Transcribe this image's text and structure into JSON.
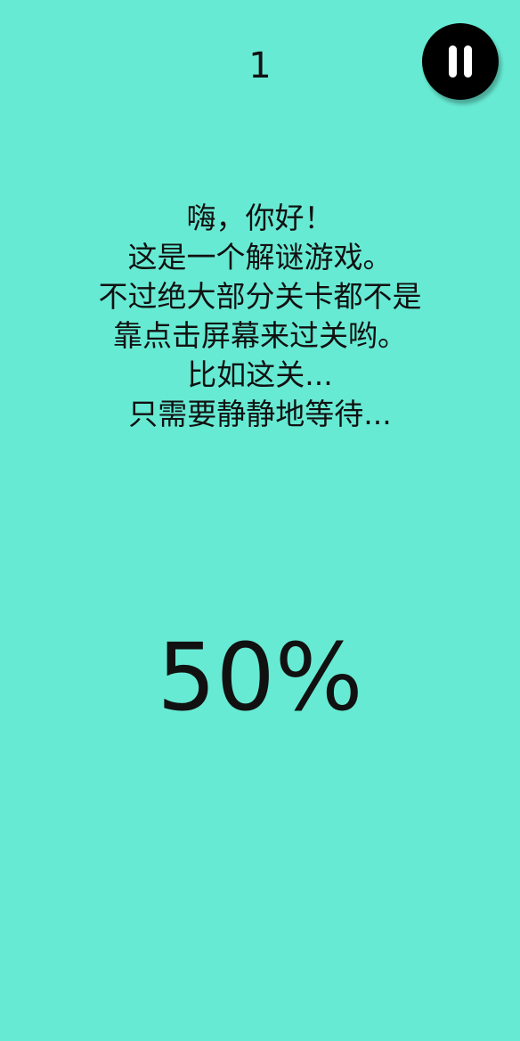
{
  "theme": {
    "background": "#67EAD3",
    "text": "#111111",
    "pause_button": "#000000"
  },
  "header": {
    "level": "1",
    "pause_icon": "pause-icon"
  },
  "message": {
    "lines": [
      "嗨，你好！",
      "这是一个解谜游戏。",
      "不过绝大部分关卡都不是",
      "靠点击屏幕来过关哟。",
      "比如这关...",
      "只需要静静地等待..."
    ]
  },
  "progress": {
    "text": "50%",
    "value": 50
  }
}
